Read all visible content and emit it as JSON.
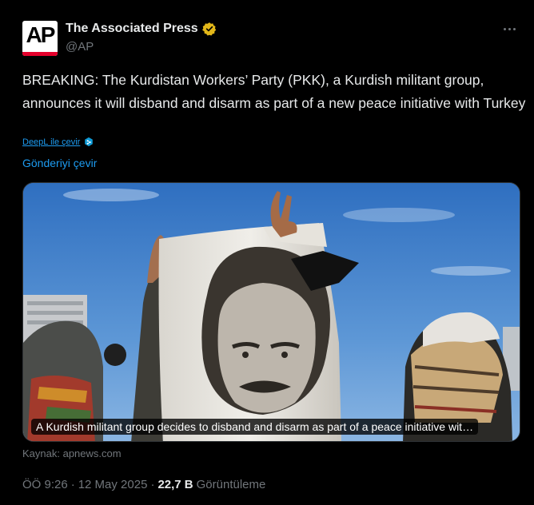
{
  "author": {
    "display_name": "The Associated Press",
    "handle": "@AP",
    "avatar_text": "AP",
    "verified_color": "#e2b719"
  },
  "tweet": {
    "text": "BREAKING: The Kurdistan Workers’ Party (PKK), a Kurdish militant group, announces it will disband and disarm as part of a new peace initiative with Turkey",
    "deepl_label": "DeepL ile çevir",
    "translate_label": "Gönderiyi çevir"
  },
  "media": {
    "caption": "A Kurdish militant group decides to disband and disarm as part of a peace initiative wit…"
  },
  "link_source": "Kaynak: apnews.com",
  "meta": {
    "time": "ÖÖ 9:26",
    "separator": "·",
    "date": "12 May 2025",
    "separator2": "·",
    "views_count": "22,7 B",
    "views_label": "Görüntüleme"
  },
  "colors": {
    "background": "#000000",
    "text": "#e7e9ea",
    "muted": "#71767b",
    "link": "#1d9bf0"
  }
}
